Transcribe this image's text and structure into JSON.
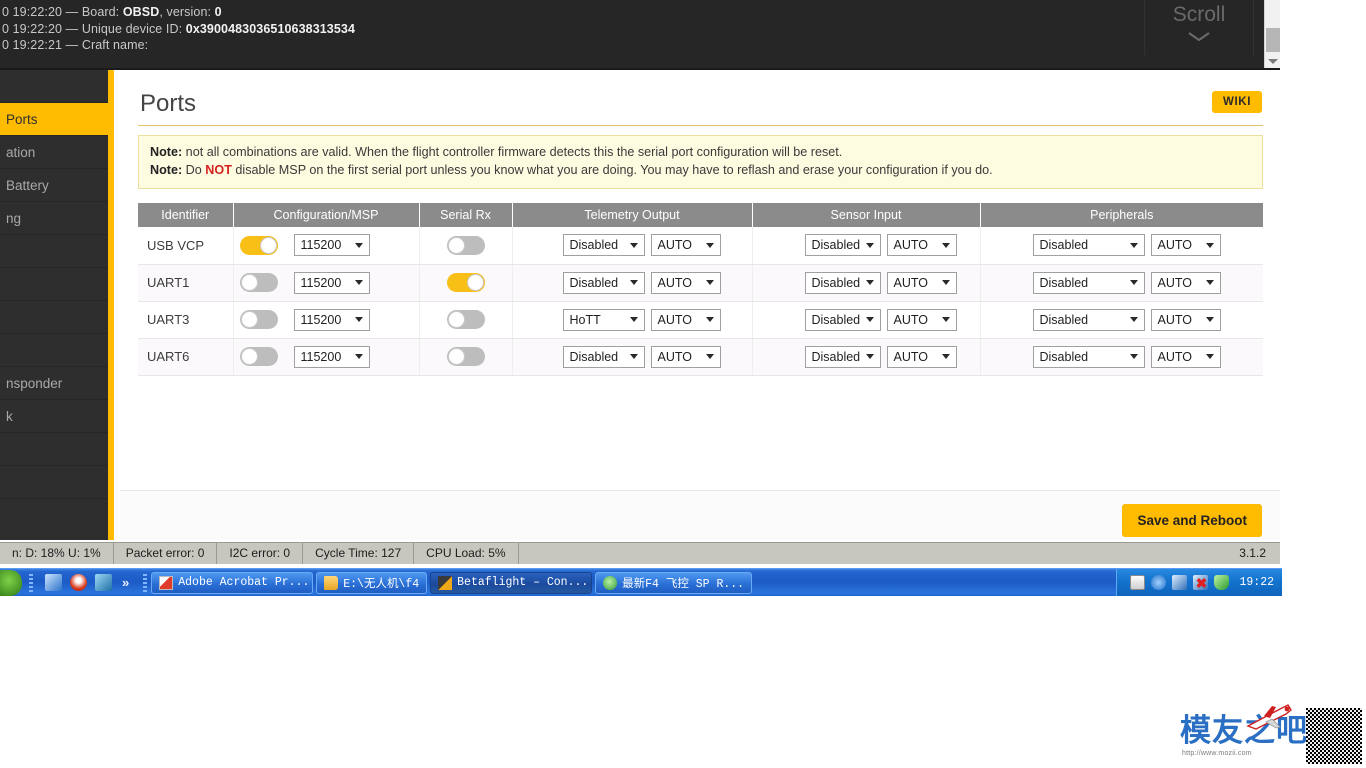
{
  "console": {
    "lines": [
      {
        "prefix": "0 19:22:20 — Board: ",
        "bold": "OBSD",
        "mid": ", version: ",
        "bold2": "0"
      },
      {
        "prefix": "0 19:22:20 — Unique device ID: ",
        "bold": "0x3900483036510638313534",
        "mid": "",
        "bold2": ""
      },
      {
        "prefix": "0 19:22:21 — Craft name:",
        "bold": "",
        "mid": "",
        "bold2": ""
      }
    ],
    "line1_full": "0 19:22:20 — Board: OBSD, version: 0",
    "line2_full": "0 19:22:20 — Unique device ID: 0x3900483036510638313534",
    "line3_full": "0 19:22:21 — Craft name:",
    "scroll_label": "Scroll",
    "scroll_icon": "chevron-down-icon"
  },
  "sidebar": {
    "items": [
      {
        "label": "",
        "active": false
      },
      {
        "label": "Ports",
        "active": true
      },
      {
        "label": "ation",
        "active": false
      },
      {
        "label": " Battery",
        "active": false
      },
      {
        "label": "ng",
        "active": false
      },
      {
        "label": "",
        "active": false
      },
      {
        "label": "",
        "active": false
      },
      {
        "label": "",
        "active": false
      },
      {
        "label": "",
        "active": false
      },
      {
        "label": "nsponder",
        "active": false
      },
      {
        "label": "k",
        "active": false
      },
      {
        "label": "",
        "active": false
      },
      {
        "label": "",
        "active": false
      }
    ]
  },
  "main": {
    "title": "Ports",
    "wiki_label": "WIKI",
    "notes": [
      {
        "label": "Note:",
        "text": " not all combinations are valid. When the flight controller firmware detects this the serial port configuration will be reset."
      },
      {
        "label": "Note:",
        "pre": " Do ",
        "negative": "NOT",
        "post": " disable MSP on the first serial port unless you know what you are doing. You may have to reflash and erase your configuration if you do."
      }
    ],
    "note2_full": "Note: Do NOT disable MSP on the first serial port unless you know what you are doing. You may have to reflash and erase your configuration if you do.",
    "save_label": "Save and Reboot"
  },
  "table": {
    "headers": [
      "Identifier",
      "Configuration/MSP",
      "Serial Rx",
      "Telemetry Output",
      "Sensor Input",
      "Peripherals"
    ],
    "rows": [
      {
        "identifier": "USB VCP",
        "msp_on": true,
        "baud": "115200",
        "serial_rx_on": false,
        "telemetry": "Disabled",
        "telemetry_baud": "AUTO",
        "sensor": "Disabled",
        "sensor_baud": "AUTO",
        "peripheral": "Disabled",
        "peripheral_baud": "AUTO"
      },
      {
        "identifier": "UART1",
        "msp_on": false,
        "baud": "115200",
        "serial_rx_on": true,
        "telemetry": "Disabled",
        "telemetry_baud": "AUTO",
        "sensor": "Disabled",
        "sensor_baud": "AUTO",
        "peripheral": "Disabled",
        "peripheral_baud": "AUTO"
      },
      {
        "identifier": "UART3",
        "msp_on": false,
        "baud": "115200",
        "serial_rx_on": false,
        "telemetry": "HoTT",
        "telemetry_baud": "AUTO",
        "sensor": "Disabled",
        "sensor_baud": "AUTO",
        "peripheral": "Disabled",
        "peripheral_baud": "AUTO"
      },
      {
        "identifier": "UART6",
        "msp_on": false,
        "baud": "115200",
        "serial_rx_on": false,
        "telemetry": "Disabled",
        "telemetry_baud": "AUTO",
        "sensor": "Disabled",
        "sensor_baud": "AUTO",
        "peripheral": "Disabled",
        "peripheral_baud": "AUTO"
      }
    ]
  },
  "statusbar": {
    "items": [
      "n: D: 18% U: 1%",
      "Packet error: 0",
      "I2C error: 0",
      "Cycle Time: 127",
      "CPU Load: 5%"
    ],
    "version": "3.1.2"
  },
  "taskbar": {
    "quick_launch": [
      {
        "name": "ie-icon"
      },
      {
        "name": "qq-penguin-icon"
      },
      {
        "name": "lite-icon"
      }
    ],
    "more_label": "»",
    "buttons": [
      {
        "label": "Adobe Acrobat Pr...",
        "icon": "pdf-icon",
        "active": false
      },
      {
        "label": "E:\\无人机\\f4",
        "icon": "folder-icon",
        "active": false
      },
      {
        "label": "Betaflight – Con...",
        "icon": "betaflight-icon",
        "active": true
      },
      {
        "label": "最新F4 飞控 SP R...",
        "icon": "browser-icon",
        "active": false
      }
    ],
    "tray_icons": [
      "keyboard-icon",
      "show-hidden-icon",
      "network-icon",
      "network-disconnected-icon",
      "security-shield-icon"
    ],
    "clock": "19:22"
  },
  "watermark": {
    "text": "模友之吧",
    "url": "http://www.mozii.com",
    "plane_icon": "airplane-icon",
    "qr_icon": "qr-code-icon"
  },
  "colors": {
    "accent": "#ffbb00",
    "note_bg": "#fdfbe0",
    "header_gray": "#8b8b8b",
    "console_bg": "#262626",
    "sidebar_bg": "#2e2e2e",
    "danger": "#d52020"
  }
}
